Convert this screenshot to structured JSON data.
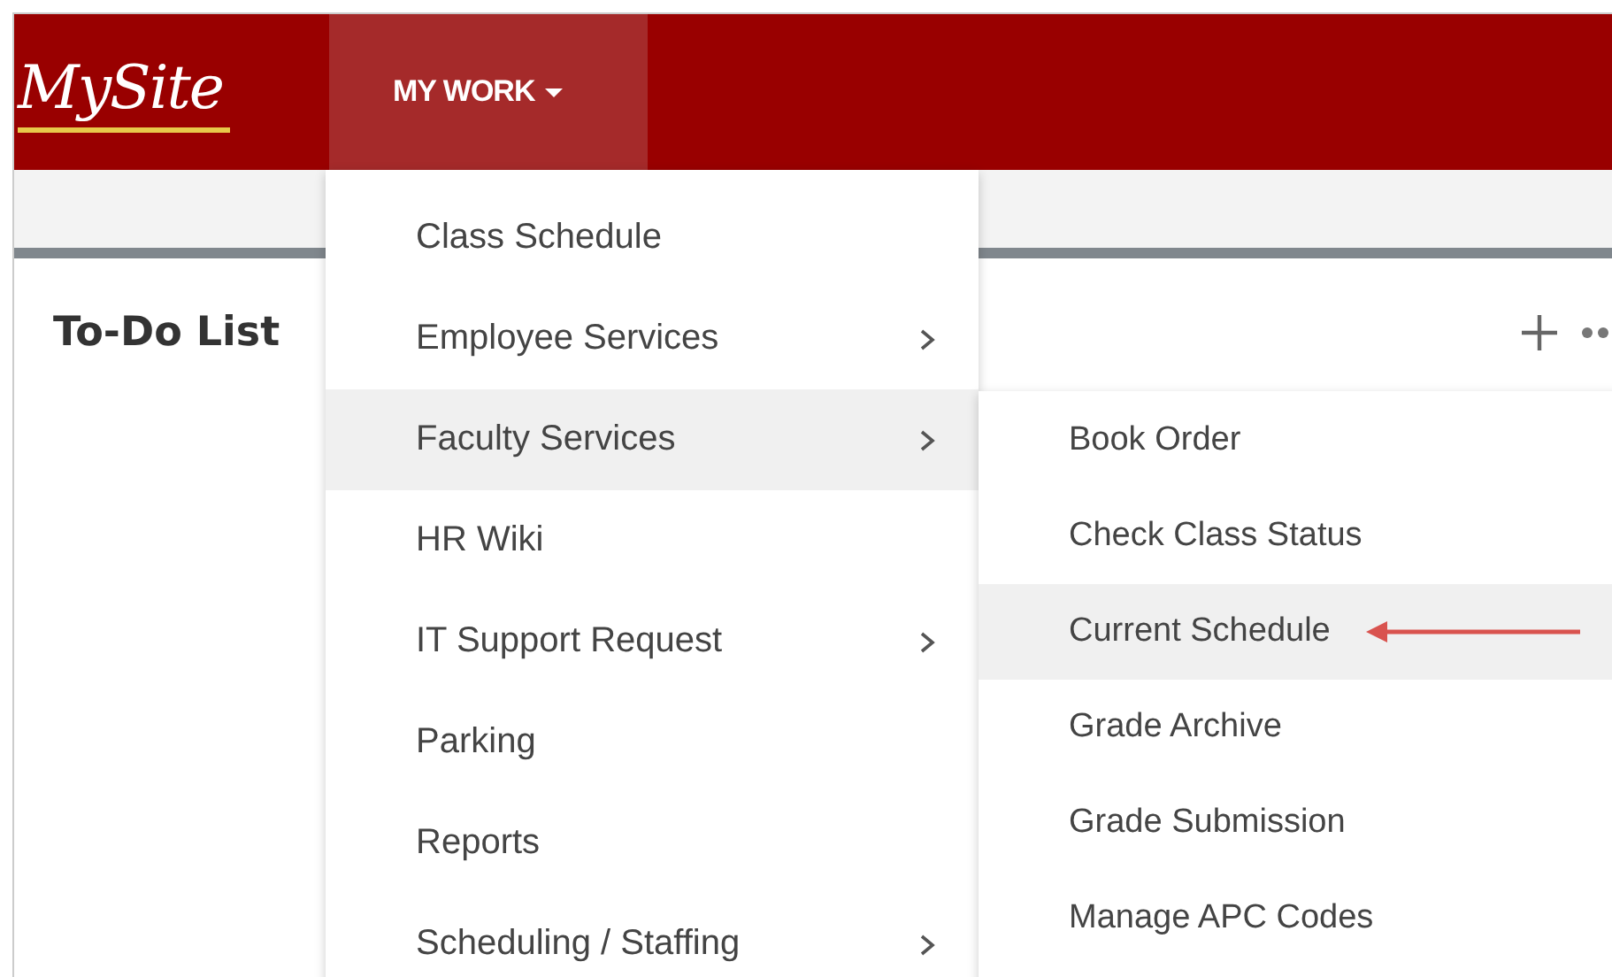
{
  "header": {
    "logo": "MySite",
    "nav": [
      {
        "label": "MY WORK",
        "expanded": true
      }
    ]
  },
  "todo": {
    "title": "To-Do List"
  },
  "menu": {
    "items": [
      {
        "label": "Class Schedule",
        "has_submenu": false,
        "selected": false
      },
      {
        "label": "Employee Services",
        "has_submenu": true,
        "selected": false
      },
      {
        "label": "Faculty Services",
        "has_submenu": true,
        "selected": true
      },
      {
        "label": "HR Wiki",
        "has_submenu": false,
        "selected": false
      },
      {
        "label": "IT Support Request",
        "has_submenu": true,
        "selected": false
      },
      {
        "label": "Parking",
        "has_submenu": false,
        "selected": false
      },
      {
        "label": "Reports",
        "has_submenu": false,
        "selected": false
      },
      {
        "label": "Scheduling / Staffing",
        "has_submenu": true,
        "selected": false
      }
    ]
  },
  "submenu": {
    "items": [
      {
        "label": "Book Order",
        "selected": false,
        "pointed_at": false
      },
      {
        "label": "Check Class Status",
        "selected": false,
        "pointed_at": false
      },
      {
        "label": "Current Schedule",
        "selected": true,
        "pointed_at": true
      },
      {
        "label": "Grade Archive",
        "selected": false,
        "pointed_at": false
      },
      {
        "label": "Grade Submission",
        "selected": false,
        "pointed_at": false
      },
      {
        "label": "Manage APC Codes",
        "selected": false,
        "pointed_at": false
      }
    ]
  }
}
